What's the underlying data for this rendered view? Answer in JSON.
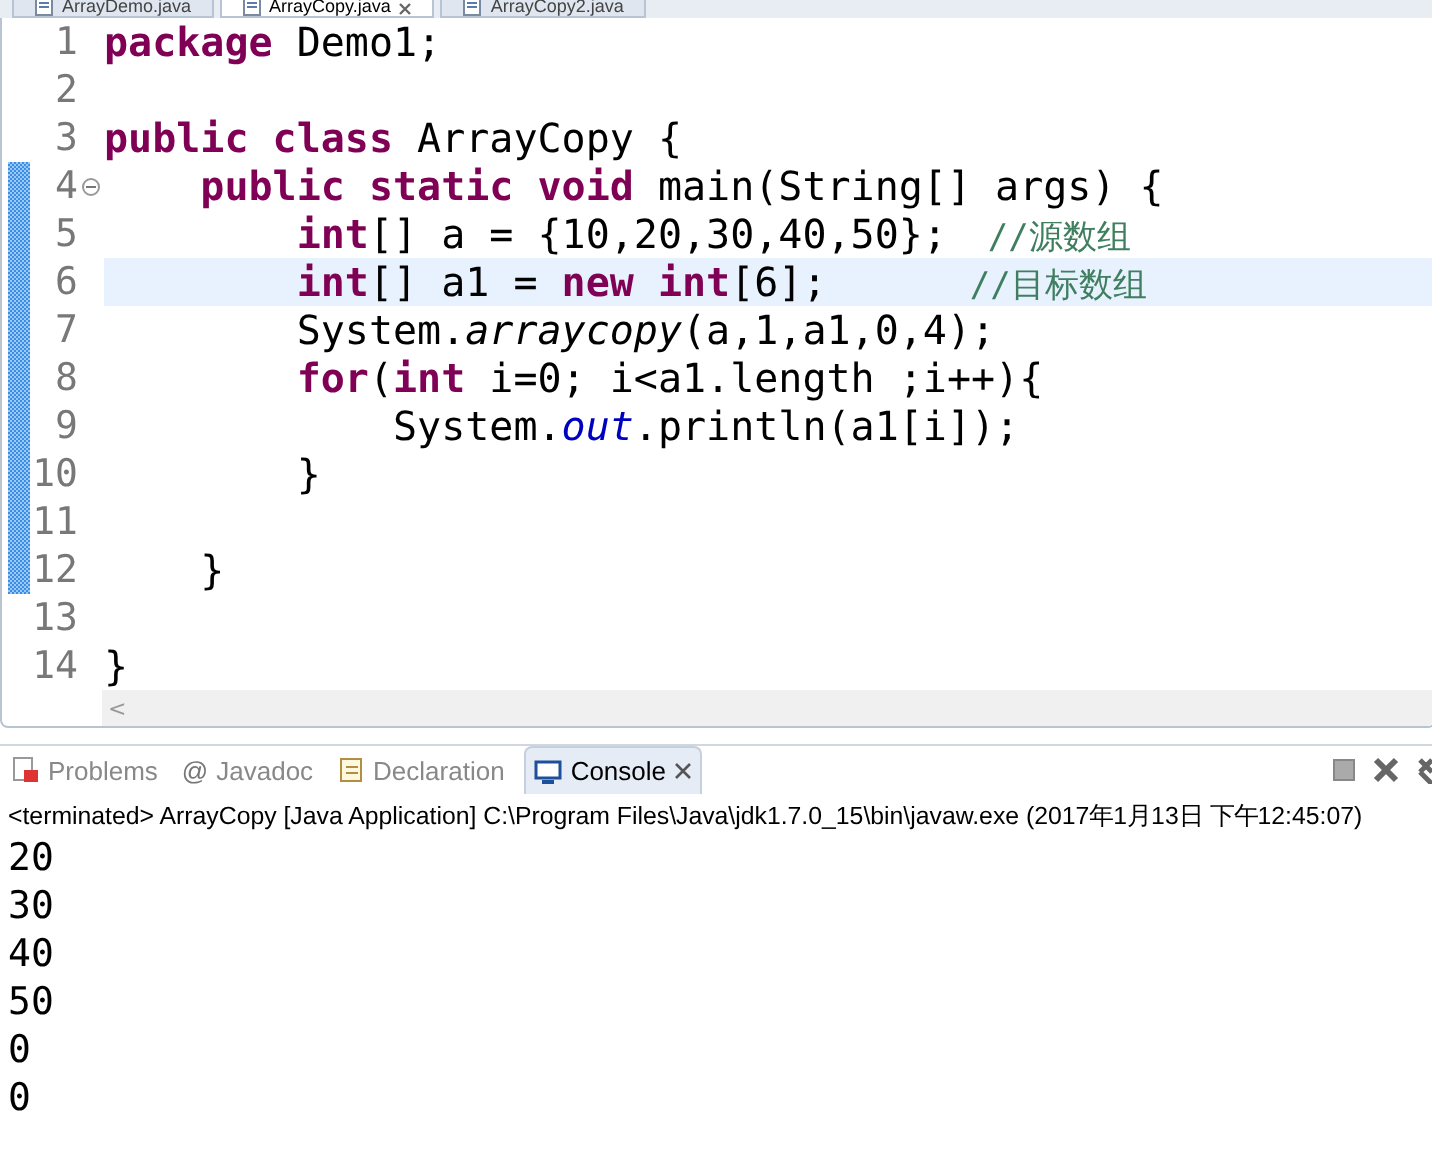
{
  "editor_tabs": [
    {
      "label": "ArrayDemo.java",
      "selected": false
    },
    {
      "label": "ArrayCopy.java",
      "selected": true
    },
    {
      "label": "ArrayCopy2.java",
      "selected": false
    }
  ],
  "code_lines": [
    {
      "number": "1",
      "current": false,
      "in_range": false,
      "fold": false,
      "tokens": [
        {
          "kind": "keyword",
          "text": "package"
        },
        {
          "kind": "plain",
          "text": " Demo1;"
        }
      ]
    },
    {
      "number": "2",
      "current": false,
      "in_range": false,
      "fold": false
    },
    {
      "number": "3",
      "current": false,
      "in_range": false,
      "fold": false,
      "tokens": [
        {
          "kind": "keyword",
          "text": "public"
        },
        {
          "kind": "keyword",
          "text": " class"
        },
        {
          "kind": "plain",
          "text": " ArrayCopy {"
        }
      ]
    },
    {
      "number": "4",
      "current": false,
      "in_range": true,
      "fold": true,
      "tokens": [
        {
          "kind": "keyword",
          "text": "    public"
        },
        {
          "kind": "keyword",
          "text": " static"
        },
        {
          "kind": "keyword",
          "text": " void"
        },
        {
          "kind": "plain",
          "text": " main(String[] args) {"
        }
      ]
    },
    {
      "number": "5",
      "current": false,
      "in_range": true,
      "fold": false,
      "tokens": [
        {
          "kind": "keyword",
          "text": "        int"
        },
        {
          "kind": "plain",
          "text": "[] a = {10,20,30,40,50};"
        },
        {
          "kind": "comment",
          "text": "  //源数组"
        }
      ]
    },
    {
      "number": "6",
      "current": true,
      "in_range": true,
      "fold": false,
      "tokens": [
        {
          "kind": "keyword",
          "text": "        int"
        },
        {
          "kind": "plain",
          "text": "[] a1 = "
        },
        {
          "kind": "keyword",
          "text": "new"
        },
        {
          "kind": "keyword",
          "text": " int"
        },
        {
          "kind": "plain",
          "text": "[6];"
        },
        {
          "kind": "comment",
          "text": "       //目标数组"
        }
      ]
    },
    {
      "number": "7",
      "current": false,
      "in_range": true,
      "fold": false,
      "tokens": [
        {
          "kind": "plain",
          "text": "        System."
        },
        {
          "kind": "static",
          "text": "arraycopy"
        },
        {
          "kind": "plain",
          "text": "(a,1,a1,0,4);"
        }
      ]
    },
    {
      "number": "8",
      "current": false,
      "in_range": true,
      "fold": false,
      "tokens": [
        {
          "kind": "keyword",
          "text": "        for"
        },
        {
          "kind": "plain",
          "text": "("
        },
        {
          "kind": "keyword",
          "text": "int"
        },
        {
          "kind": "plain",
          "text": " i=0; i<a1.length ;i++){"
        }
      ]
    },
    {
      "number": "9",
      "current": false,
      "in_range": true,
      "fold": false,
      "tokens": [
        {
          "kind": "plain",
          "text": "            System."
        },
        {
          "kind": "field",
          "text": "out"
        },
        {
          "kind": "plain",
          "text": ".println(a1[i]);"
        }
      ]
    },
    {
      "number": "10",
      "current": false,
      "in_range": true,
      "fold": false,
      "tokens": [
        {
          "kind": "plain",
          "text": "        }"
        }
      ]
    },
    {
      "number": "11",
      "current": false,
      "in_range": true,
      "fold": false
    },
    {
      "number": "12",
      "current": false,
      "in_range": true,
      "fold": false,
      "tokens": [
        {
          "kind": "plain",
          "text": "    }"
        }
      ]
    },
    {
      "number": "13",
      "current": false,
      "in_range": false,
      "fold": false
    },
    {
      "number": "14",
      "current": false,
      "in_range": false,
      "fold": false,
      "tokens": [
        {
          "kind": "plain",
          "text": "}"
        }
      ]
    }
  ],
  "scrollbar": {
    "left_arrow": "<"
  },
  "view_tabs": [
    {
      "label": "Problems",
      "kind": "problems",
      "selected": false
    },
    {
      "label": "Javadoc",
      "kind": "javadoc",
      "icon_glyph": "@",
      "selected": false
    },
    {
      "label": "Declaration",
      "kind": "declaration",
      "selected": false
    },
    {
      "label": "Console",
      "kind": "console",
      "selected": true
    }
  ],
  "console": {
    "header": "<terminated> ArrayCopy [Java Application] C:\\Program Files\\Java\\jdk1.7.0_15\\bin\\javaw.exe (2017年1月13日 下午12:45:07)",
    "output": [
      "20",
      "30",
      "40",
      "50",
      "0",
      "0"
    ]
  }
}
